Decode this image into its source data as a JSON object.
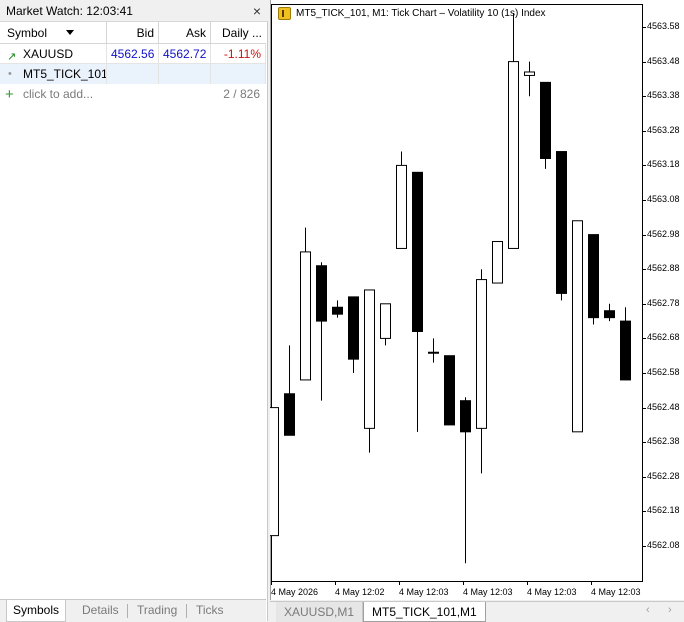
{
  "market_watch": {
    "title": "Market Watch: 12:03:41",
    "close_label": "×",
    "columns": {
      "symbol": "Symbol",
      "bid": "Bid",
      "ask": "Ask",
      "daily": "Daily ..."
    },
    "rows": [
      {
        "symbol": "XAUUSD",
        "bid": "4562.56",
        "ask": "4562.72",
        "change": "-1.11%",
        "icon": "up-arrow-icon"
      },
      {
        "symbol": "MT5_TICK_101",
        "bid": "",
        "ask": "",
        "change": "",
        "icon": "dot-icon"
      }
    ],
    "add_label": "click to add...",
    "count": "2 / 826",
    "tabs": [
      "Symbols",
      "Details",
      "Trading",
      "Ticks"
    ],
    "active_tab": "Symbols"
  },
  "chart": {
    "title": "MT5_TICK_101, M1:  Tick Chart – Volatility 10 (1s) Index",
    "y_labels": [
      "4563.58",
      "4563.48",
      "4563.38",
      "4563.28",
      "4563.18",
      "4563.08",
      "4562.98",
      "4562.88",
      "4562.78",
      "4562.68",
      "4562.58",
      "4562.48",
      "4562.38",
      "4562.28",
      "4562.18",
      "4562.08"
    ],
    "x_labels": [
      "4 May 2026",
      "4 May 12:02",
      "4 May 12:03",
      "4 May 12:03",
      "4 May 12:03",
      "4 May 12:03"
    ],
    "tabs": [
      "XAUUSD,M1",
      "MT5_TICK_101,M1"
    ],
    "active_tab": "MT5_TICK_101,M1",
    "colors": {
      "bull": "#ffffff",
      "bear": "#000000",
      "outline": "#000000"
    }
  },
  "chart_data": {
    "type": "candlestick",
    "title": "MT5_TICK_101, M1:  Tick Chart – Volatility 10 (1s) Index",
    "ylim": [
      4562.0,
      4563.62
    ],
    "candles": [
      {
        "open": 4562.11,
        "high": 4562.48,
        "low": 4562.11,
        "close": 4562.48
      },
      {
        "open": 4562.52,
        "high": 4562.66,
        "low": 4562.4,
        "close": 4562.4
      },
      {
        "open": 4562.56,
        "high": 4563.0,
        "low": 4562.56,
        "close": 4562.93
      },
      {
        "open": 4562.89,
        "high": 4562.9,
        "low": 4562.5,
        "close": 4562.73
      },
      {
        "open": 4562.77,
        "high": 4562.79,
        "low": 4562.74,
        "close": 4562.75
      },
      {
        "open": 4562.8,
        "high": 4562.8,
        "low": 4562.58,
        "close": 4562.62
      },
      {
        "open": 4562.42,
        "high": 4562.82,
        "low": 4562.35,
        "close": 4562.82
      },
      {
        "open": 4562.68,
        "high": 4562.78,
        "low": 4562.66,
        "close": 4562.78
      },
      {
        "open": 4562.94,
        "high": 4563.22,
        "low": 4562.94,
        "close": 4563.18
      },
      {
        "open": 4563.16,
        "high": 4563.16,
        "low": 4562.41,
        "close": 4562.7
      },
      {
        "open": 4562.64,
        "high": 4562.68,
        "low": 4562.61,
        "close": 4562.64
      },
      {
        "open": 4562.63,
        "high": 4562.63,
        "low": 4562.43,
        "close": 4562.43
      },
      {
        "open": 4562.5,
        "high": 4562.51,
        "low": 4562.03,
        "close": 4562.41
      },
      {
        "open": 4562.42,
        "high": 4562.88,
        "low": 4562.29,
        "close": 4562.85
      },
      {
        "open": 4562.84,
        "high": 4562.96,
        "low": 4562.84,
        "close": 4562.96
      },
      {
        "open": 4562.94,
        "high": 4563.62,
        "low": 4562.94,
        "close": 4563.48
      },
      {
        "open": 4563.44,
        "high": 4563.48,
        "low": 4563.38,
        "close": 4563.45
      },
      {
        "open": 4563.42,
        "high": 4563.42,
        "low": 4563.17,
        "close": 4563.2
      },
      {
        "open": 4563.22,
        "high": 4563.22,
        "low": 4562.79,
        "close": 4562.81
      },
      {
        "open": 4562.41,
        "high": 4563.02,
        "low": 4562.41,
        "close": 4563.02
      },
      {
        "open": 4562.98,
        "high": 4562.98,
        "low": 4562.72,
        "close": 4562.74
      },
      {
        "open": 4562.76,
        "high": 4562.78,
        "low": 4562.73,
        "close": 4562.74
      },
      {
        "open": 4562.73,
        "high": 4562.77,
        "low": 4562.56,
        "close": 4562.56
      }
    ]
  }
}
